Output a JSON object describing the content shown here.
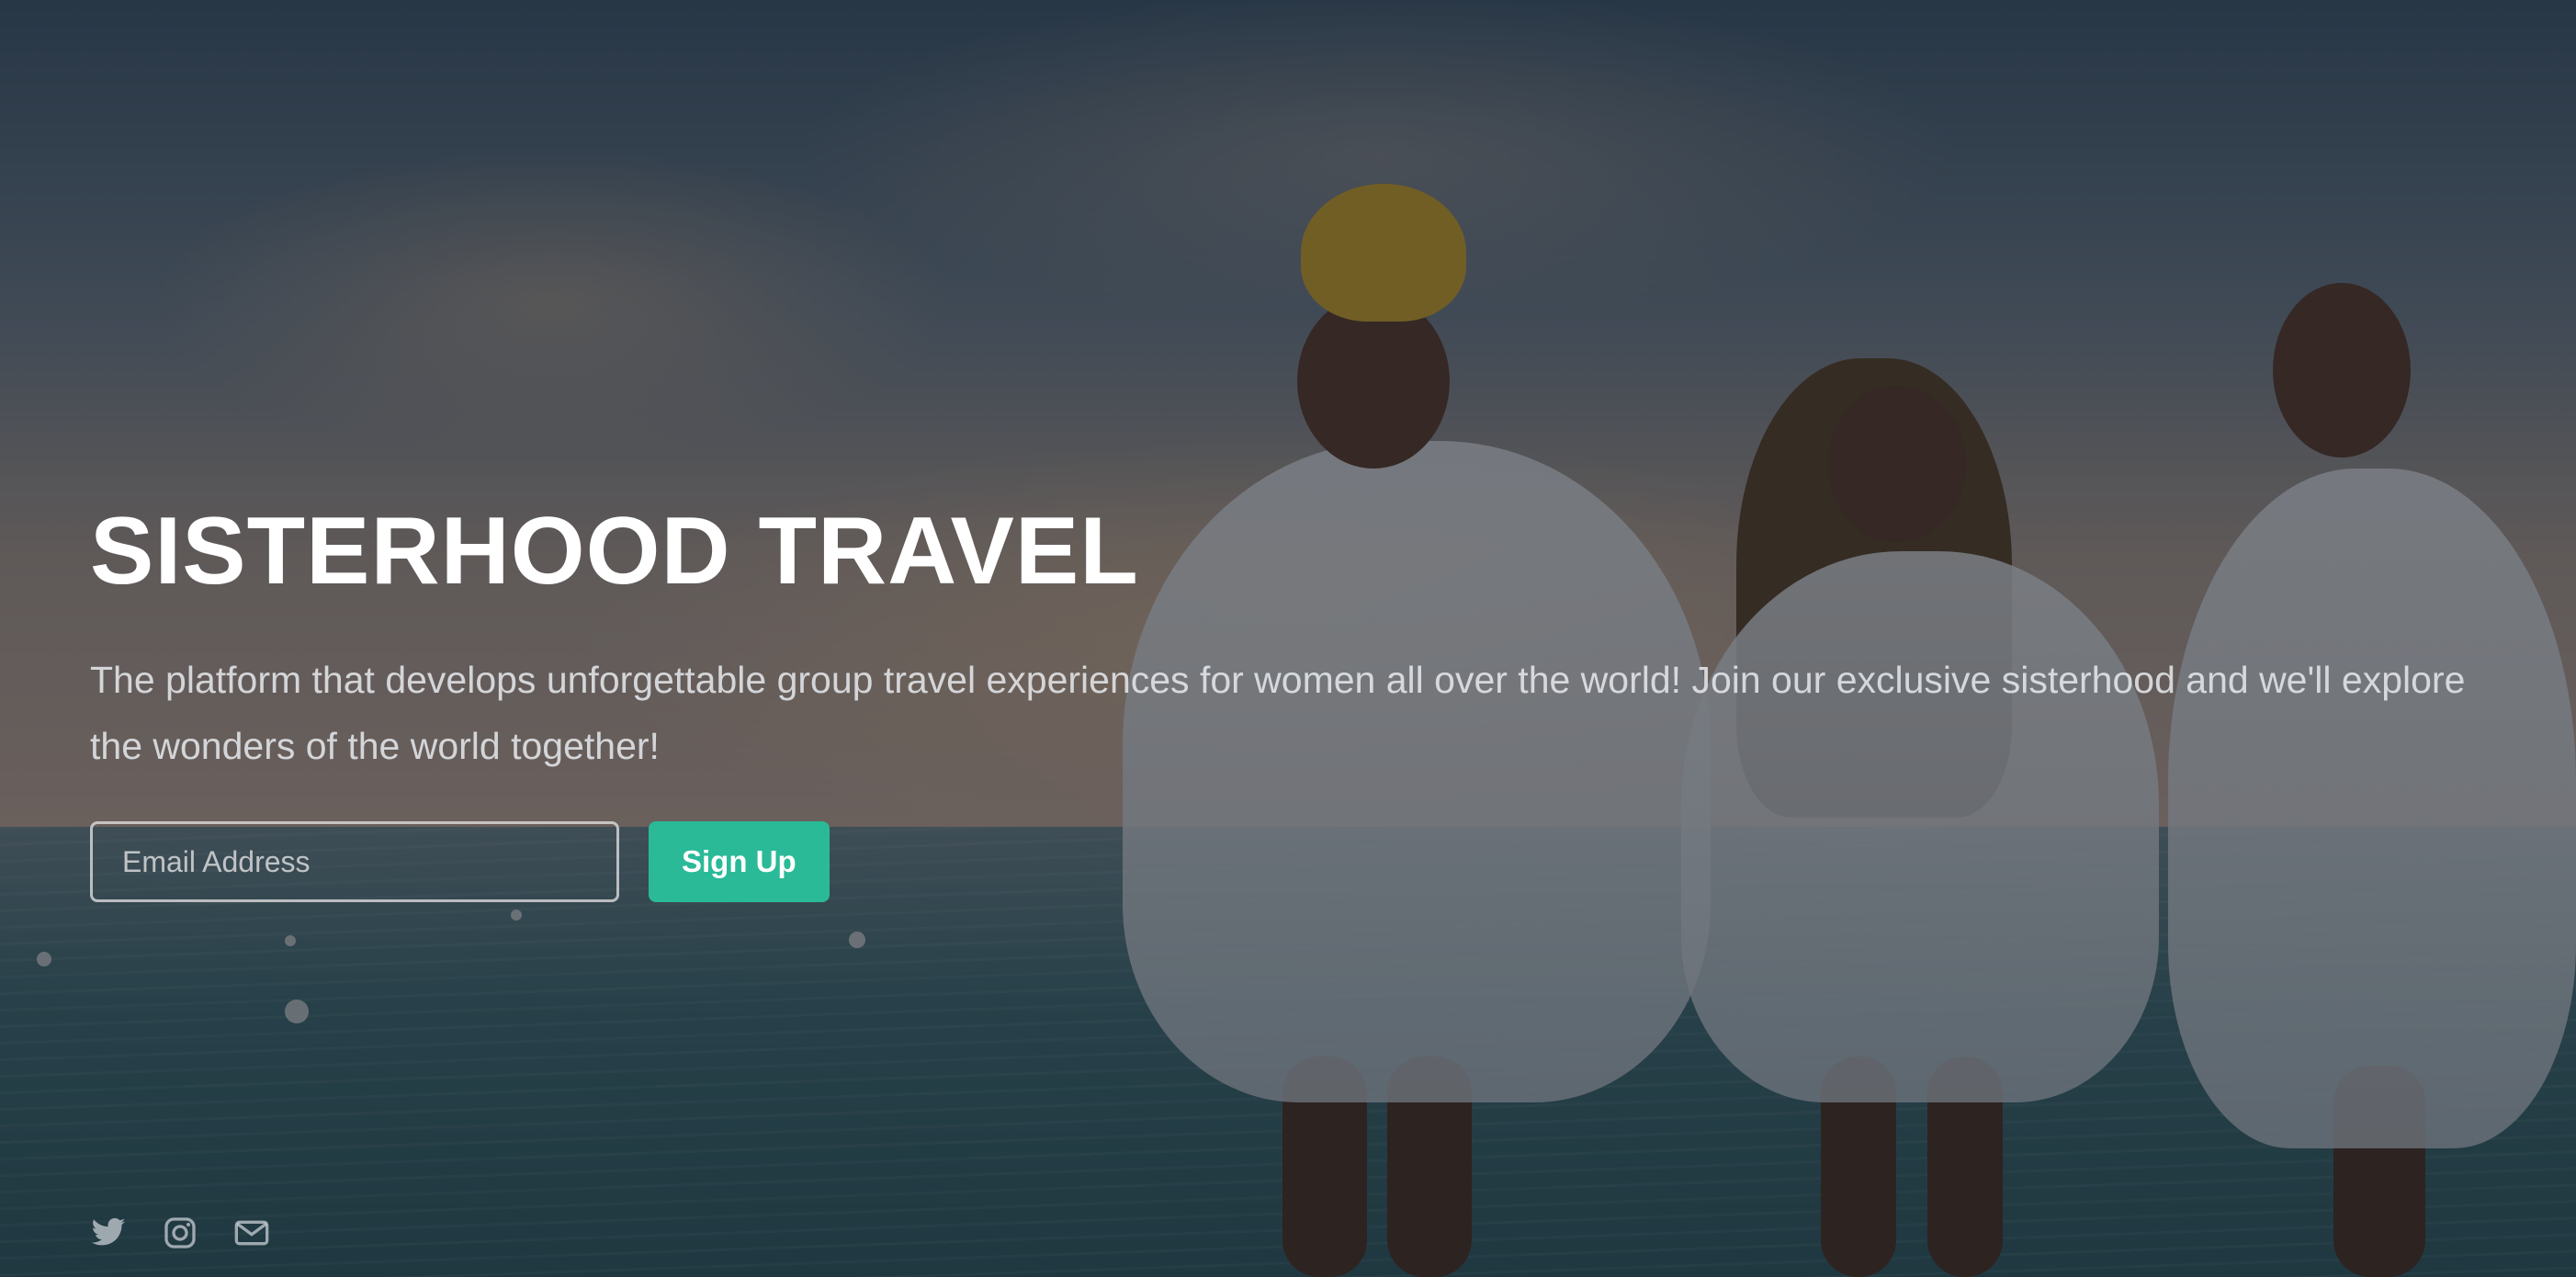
{
  "hero": {
    "title": "SISTERHOOD TRAVEL",
    "subtitle": "The platform that develops unforgettable group travel experiences for women all over the world! Join our exclusive sisterhood and we'll explore the wonders of the world together!"
  },
  "signup": {
    "email_placeholder": "Email Address",
    "button_label": "Sign Up"
  },
  "social": {
    "icons": [
      "twitter-icon",
      "instagram-icon",
      "mail-icon"
    ]
  },
  "colors": {
    "accent": "#2aba97",
    "text": "#ffffff"
  }
}
